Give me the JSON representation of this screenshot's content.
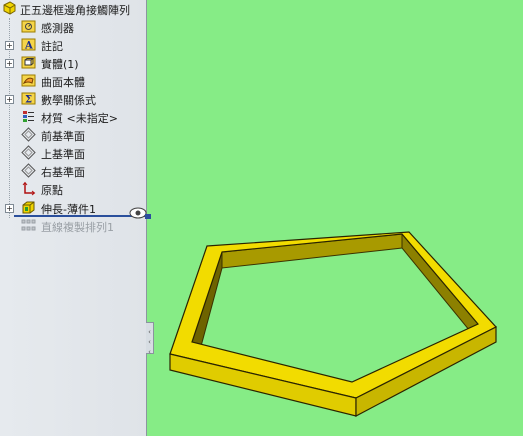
{
  "feature_tree": {
    "root": {
      "label": "正五邊框邊角接觸陣列",
      "icon": "part-icon"
    },
    "items": [
      {
        "label": "感測器",
        "icon": "sensor-icon",
        "expandable": false
      },
      {
        "label": "註記",
        "icon": "annotation-icon",
        "expandable": true
      },
      {
        "label": "實體(1)",
        "icon": "solid-body-icon",
        "expandable": true
      },
      {
        "label": "曲面本體",
        "icon": "surface-body-icon",
        "expandable": false
      },
      {
        "label": "數學關係式",
        "icon": "equation-icon",
        "expandable": true
      },
      {
        "label": "材質 <未指定>",
        "icon": "material-icon",
        "expandable": false
      },
      {
        "label": "前基準面",
        "icon": "plane-icon",
        "expandable": false
      },
      {
        "label": "上基準面",
        "icon": "plane-icon",
        "expandable": false
      },
      {
        "label": "右基準面",
        "icon": "plane-icon",
        "expandable": false
      },
      {
        "label": "原點",
        "icon": "origin-icon",
        "expandable": false
      },
      {
        "label": "伸長-薄件1",
        "icon": "extrude-icon",
        "expandable": true
      },
      {
        "label": "直線複製排列1",
        "icon": "linear-pattern-icon",
        "expandable": false,
        "suppressed": true
      }
    ],
    "expand_symbol": "+"
  },
  "viewport": {
    "background": "#86ec86",
    "model_color": "#f2dc00",
    "model_shade": "#a89a00",
    "model_dark": "#5a5200"
  }
}
